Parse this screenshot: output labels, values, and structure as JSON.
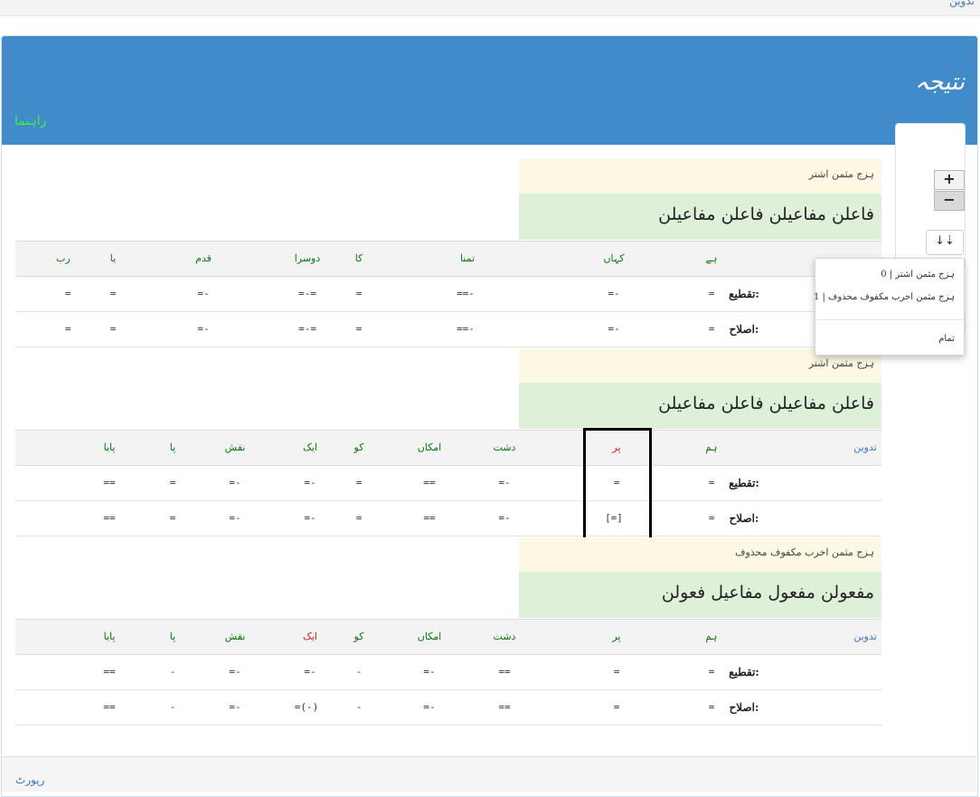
{
  "top_link": "تدوین",
  "panel": {
    "title": "نتیجہ",
    "guide": "راہنما"
  },
  "zoom": {
    "in": "+",
    "out": "−"
  },
  "sort_button": "↓⇣",
  "dropdown": {
    "options": [
      "ہزج مثمن اشتر | 0",
      "ہزج مثمن اخرب مکفوف محذوف | 1"
    ],
    "done": "تمام"
  },
  "labels": {
    "taqti": "تقطیع:",
    "islah": "اصلاح:"
  },
  "blocks": [
    {
      "meter": "ہزج مثمن اشتر",
      "pattern": "فاعلن مفاعیلن فاعلن مفاعیلن",
      "words": [
        {
          "t": "رب",
          "c": "w"
        },
        {
          "t": "یا",
          "c": "w"
        },
        {
          "t": "قدم",
          "c": "w"
        },
        {
          "t": "دوسرا",
          "c": "w"
        },
        {
          "t": "کا",
          "c": "w"
        },
        {
          "t": "تمنا",
          "c": "w"
        },
        {
          "t": "کہاں",
          "c": "w"
        },
        {
          "t": "ہے",
          "c": "w"
        },
        {
          "t": "",
          "c": "w blue"
        }
      ],
      "taqti": [
        "=",
        "=",
        "=-",
        "=-=",
        "=",
        "==-",
        "=-",
        "="
      ],
      "islah": [
        "=",
        "=",
        "=-",
        "=-=",
        "=",
        "==-",
        "=-",
        "="
      ]
    },
    {
      "meter": "ہزج مثمن اشتر",
      "pattern": "فاعلن مفاعیلن فاعلن مفاعیلن",
      "words": [
        {
          "t": "",
          "c": "w"
        },
        {
          "t": "پایا",
          "c": "w"
        },
        {
          "t": "پا",
          "c": "w"
        },
        {
          "t": "نقش",
          "c": "w"
        },
        {
          "t": "ایک",
          "c": "w"
        },
        {
          "t": "کو",
          "c": "w"
        },
        {
          "t": "امکاں",
          "c": "w"
        },
        {
          "t": "دشت",
          "c": "w"
        },
        {
          "t": "پر",
          "c": "w red"
        },
        {
          "t": "ہم",
          "c": "w"
        },
        {
          "t": "تدوین",
          "c": "w blue"
        }
      ],
      "taqti": [
        "",
        "==",
        "=",
        "=-",
        "=-",
        "=",
        "==",
        "=-",
        "=",
        "="
      ],
      "islah": [
        "",
        "==",
        "=",
        "=-",
        "=-",
        "=",
        "==",
        "=-",
        "[=]",
        "="
      ]
    },
    {
      "meter": "ہزج مثمن اخرب مکفوف محذوف",
      "pattern": "مفعولن مفعول مفاعیل فعولن",
      "words": [
        {
          "t": "",
          "c": "w"
        },
        {
          "t": "پایا",
          "c": "w"
        },
        {
          "t": "پا",
          "c": "w"
        },
        {
          "t": "نقش",
          "c": "w"
        },
        {
          "t": "ایک",
          "c": "w red"
        },
        {
          "t": "کو",
          "c": "w"
        },
        {
          "t": "امکاں",
          "c": "w"
        },
        {
          "t": "دشت",
          "c": "w"
        },
        {
          "t": "پر",
          "c": "w"
        },
        {
          "t": "ہم",
          "c": "w"
        },
        {
          "t": "تدوین",
          "c": "w blue"
        }
      ],
      "taqti": [
        "",
        "==",
        "-",
        "=-",
        "=-",
        "-",
        "=-",
        "==",
        "=",
        "="
      ],
      "islah": [
        "",
        "==",
        "-",
        "=-",
        "=(-)",
        "-",
        "=-",
        "==",
        "=",
        "="
      ]
    }
  ],
  "footer": {
    "report": "رپورٹ"
  }
}
